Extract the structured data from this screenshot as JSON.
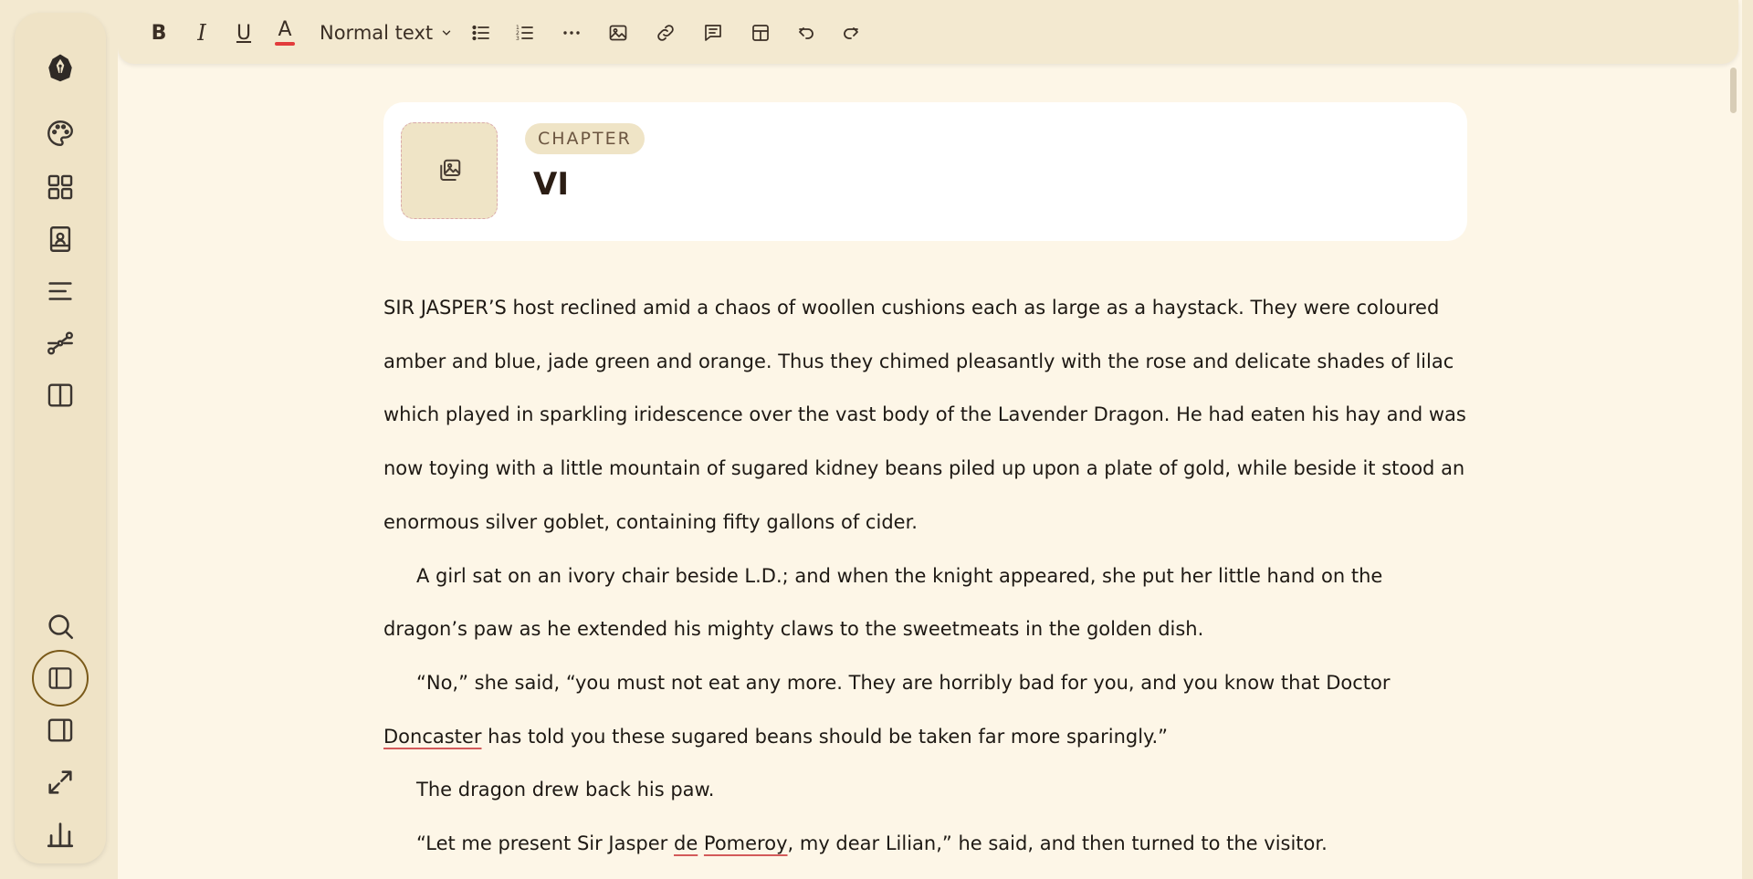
{
  "toolbar": {
    "bold": "B",
    "italic": "I",
    "underline": "U",
    "text_color": "A",
    "text_color_hex": "#e23c3c",
    "paragraph_style": "Normal text",
    "icons": [
      "bulleted-list-icon",
      "numbered-list-icon",
      "more-icon",
      "image-icon",
      "link-icon",
      "comment-icon",
      "table-icon",
      "undo-icon",
      "redo-icon"
    ]
  },
  "rail": {
    "icons": [
      "logo-icon",
      "palette-icon",
      "grid-icon",
      "contacts-book-icon",
      "text-lines-icon",
      "plot-path-icon",
      "columns-icon",
      "search-icon",
      "left-panel-icon",
      "right-panel-icon",
      "expand-icon",
      "stats-icon"
    ],
    "active": "left-panel-icon"
  },
  "chapter": {
    "badge": "CHAPTER",
    "title": "VI"
  },
  "paragraphs": [
    {
      "parts": [
        {
          "t": "SIR JASPER’S host reclined amid a chaos of woollen cushions each as large as a haystack. They were coloured amber and blue, jade green and orange. Thus they chimed pleasantly with the rose and delicate shades of lilac which played in sparkling iridescence over the vast body of the Lavender Dragon. He had eaten his hay and was now toying with a little mountain of sugared kidney beans piled up upon a plate of gold, while beside it stood an enormous silver goblet, containing fifty gallons of cider."
        }
      ]
    },
    {
      "parts": [
        {
          "t": "A girl sat on an ivory chair beside L.D.; and when the knight appeared, she put her little hand on the dragon’s paw as he extended his mighty claws to the sweetmeats in the golden dish."
        }
      ]
    },
    {
      "parts": [
        {
          "t": "“No,” she said, “you must not eat any more. They are horribly bad for you, and you know that Doctor "
        },
        {
          "t": "Doncaster",
          "spell": true
        },
        {
          "t": " has told you these sugared beans should be taken far more sparingly.”"
        }
      ]
    },
    {
      "parts": [
        {
          "t": "The dragon drew back his paw."
        }
      ]
    },
    {
      "parts": [
        {
          "t": "“Let me present Sir Jasper "
        },
        {
          "t": "de",
          "spell": true
        },
        {
          "t": " "
        },
        {
          "t": "Pomeroy",
          "spell": true
        },
        {
          "t": ", my dear Lilian,” he said, and then turned to the visitor."
        }
      ]
    }
  ]
}
